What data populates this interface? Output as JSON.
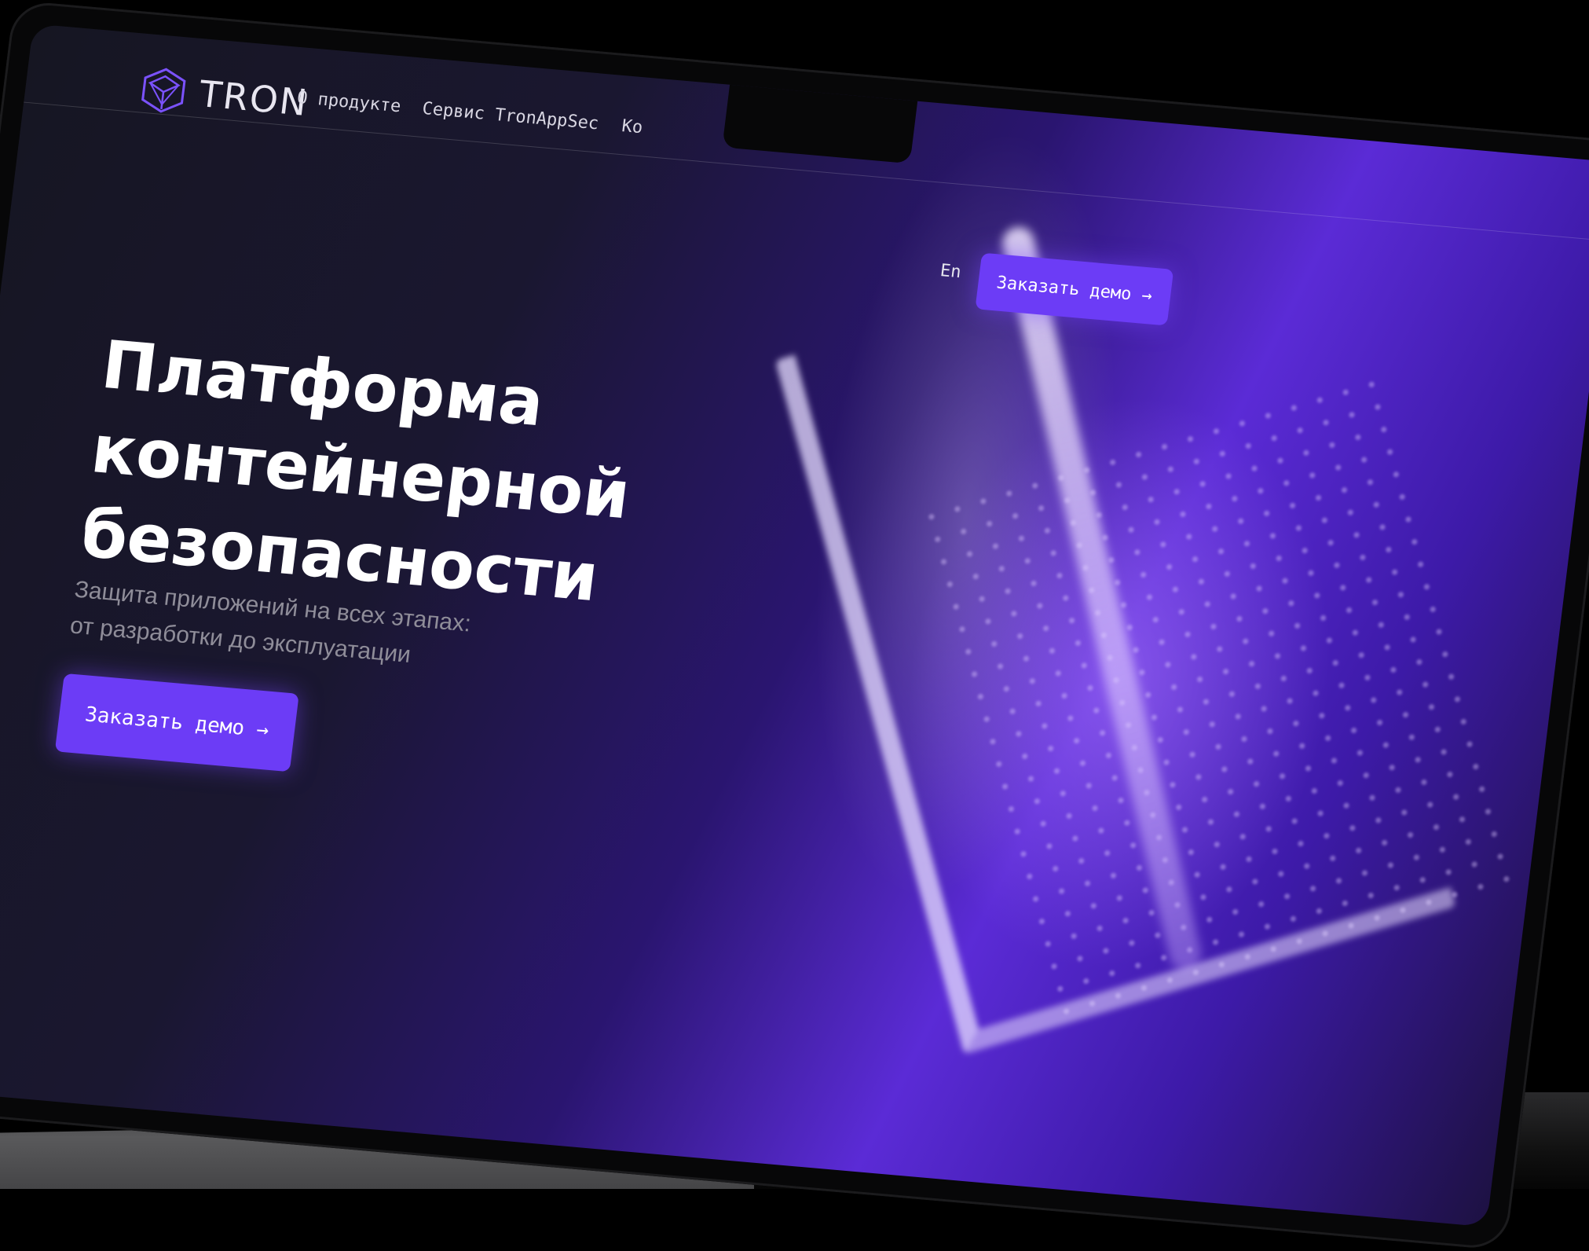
{
  "brand": {
    "name": "TRON",
    "accent": "#6c3cf6"
  },
  "nav": {
    "items": [
      {
        "label": "О продукте"
      },
      {
        "label": "Сервис TronAppSec"
      },
      {
        "label": "Ко"
      }
    ],
    "language": "En",
    "cta": "Заказать демо →"
  },
  "hero": {
    "title_lines": [
      "Платформа",
      "контейнерной",
      "безопасности"
    ],
    "subtitle_lines": [
      "Защита приложений на всех этапах:",
      "от разработки до эксплуатации"
    ],
    "cta": "Заказать демо →"
  }
}
